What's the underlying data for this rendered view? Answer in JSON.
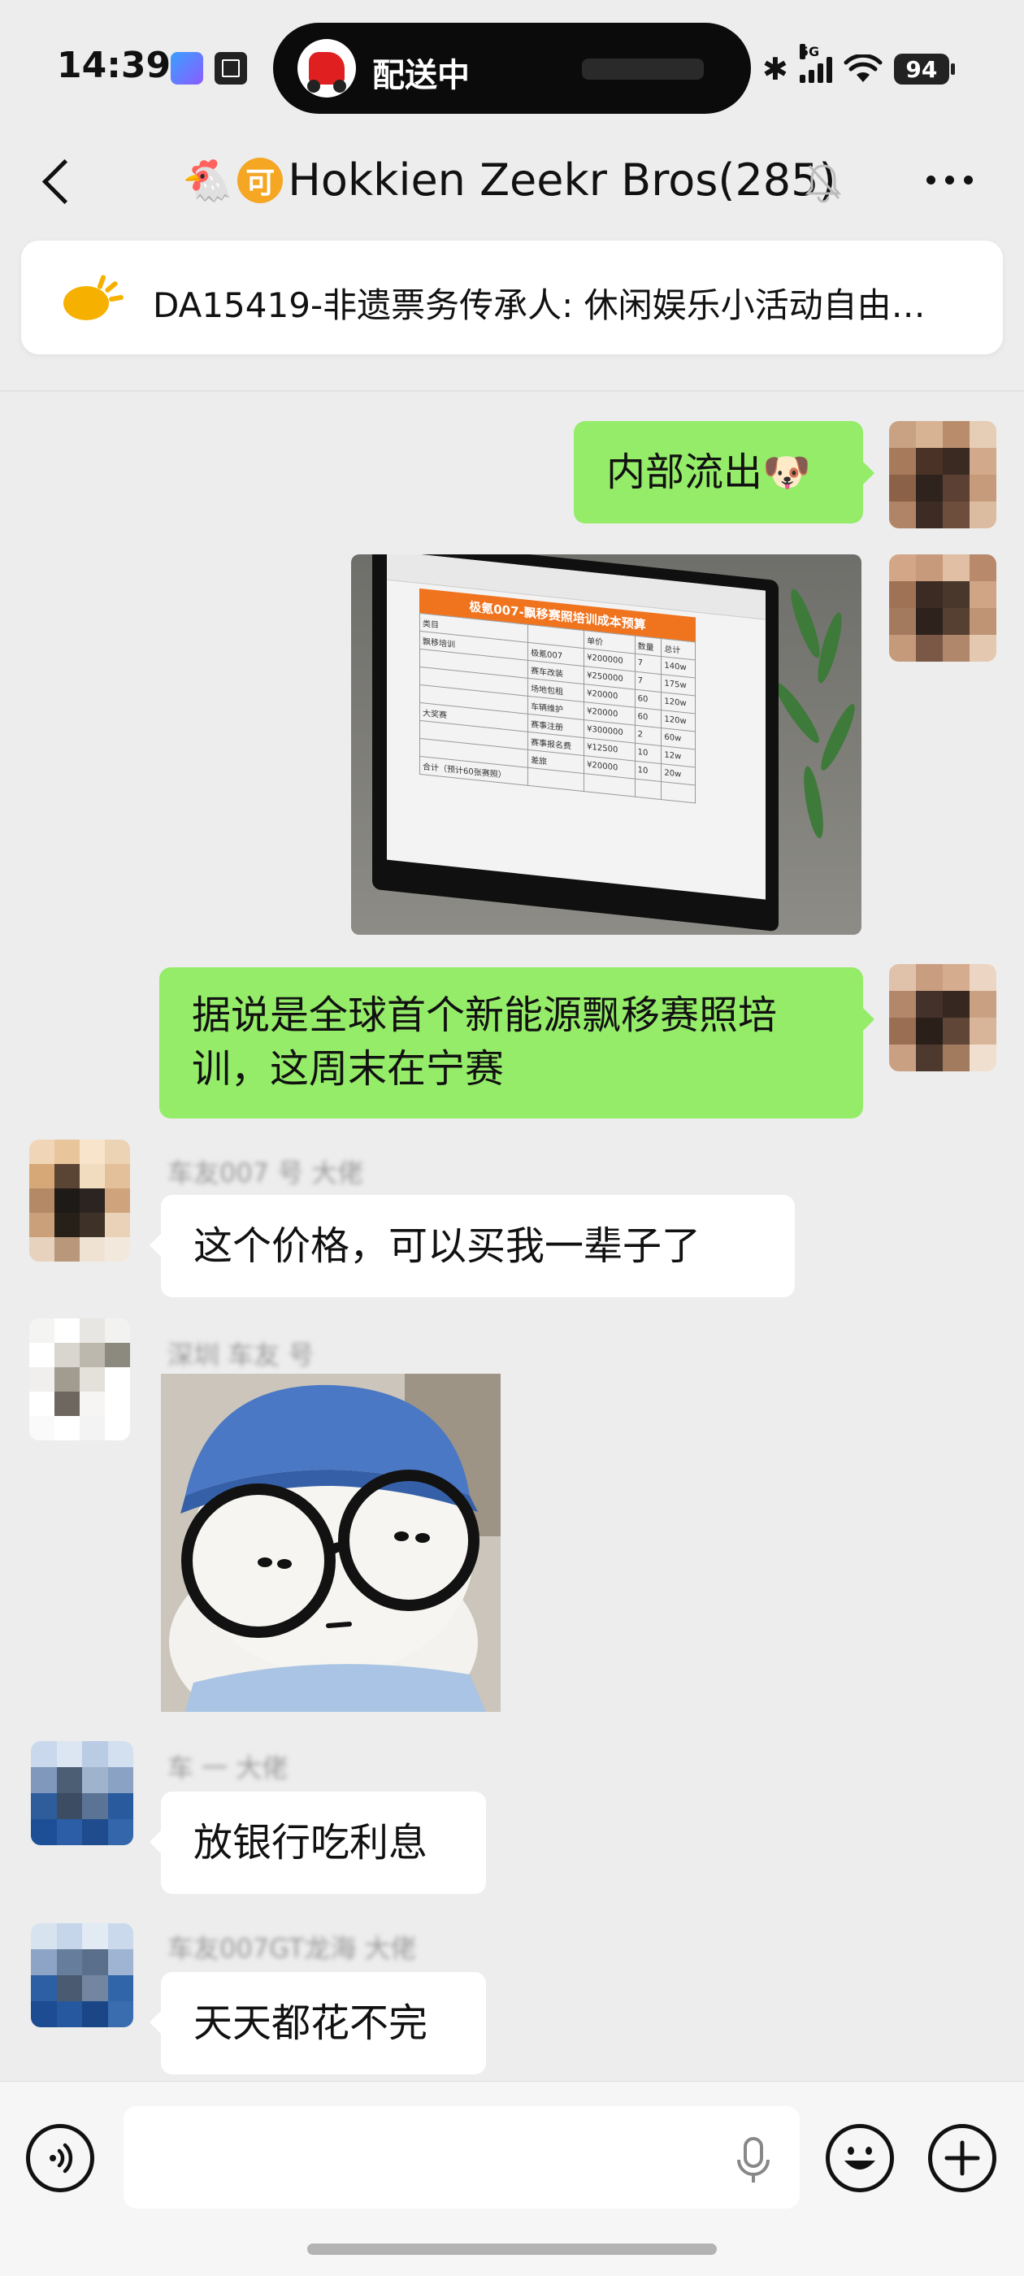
{
  "status_bar": {
    "time": "14:39",
    "live_activity_text": "配送中",
    "network": "5G",
    "battery": "94"
  },
  "header": {
    "title": "Hokkien Zeekr Bros(285)",
    "title_badge": "可",
    "title_emoji": "🐔"
  },
  "announcement": {
    "text": "DA15419-非遗票务传承人: 休闲娱乐小活动自由…"
  },
  "messages": [
    {
      "direction": "out",
      "type": "text",
      "text": "内部流出",
      "emoji": "🐶"
    },
    {
      "direction": "out",
      "type": "image",
      "image": {
        "sheet_title": "极氪007-飘移赛照培训成本预算",
        "rows": [
          [
            "类目",
            "",
            "单价",
            "数量",
            "总计"
          ],
          [
            "飘移培训",
            "极氪007",
            "¥200000",
            "7",
            "140w"
          ],
          [
            "",
            "赛车改装",
            "¥250000",
            "7",
            "175w"
          ],
          [
            "",
            "场地包租",
            "¥20000",
            "60",
            "120w"
          ],
          [
            "",
            "车辆维护",
            "¥20000",
            "60",
            "120w"
          ],
          [
            "大奖赛",
            "赛事注册",
            "¥300000",
            "2",
            "60w"
          ],
          [
            "",
            "赛事报名费",
            "¥12500",
            "10",
            "12w"
          ],
          [
            "",
            "差旅",
            "¥20000",
            "10",
            "20w"
          ],
          [
            "合计（预计60张赛照）",
            "",
            "",
            "",
            ""
          ]
        ]
      }
    },
    {
      "direction": "out",
      "type": "text",
      "text": "据说是全球首个新能源飘移赛照培训，这周末在宁赛"
    },
    {
      "direction": "in",
      "type": "text",
      "sender": "车友007 号 大佬",
      "text": "这个价格，可以买我一辈子了"
    },
    {
      "direction": "in",
      "type": "sticker",
      "sender": "深圳 车友 号"
    },
    {
      "direction": "in",
      "type": "text",
      "sender": "车 一 大佬",
      "text": "放银行吃利息"
    },
    {
      "direction": "in",
      "type": "text",
      "sender": "车友007GT龙海 大佬",
      "text": "天天都花不完"
    }
  ],
  "input_bar": {
    "value": "",
    "icons": [
      "voice-icon",
      "microphone-icon",
      "emoji-icon",
      "plus-icon"
    ]
  },
  "colors": {
    "background": "#ededed",
    "outgoing_bubble": "#95ec69",
    "incoming_bubble": "#ffffff",
    "badge_orange": "#f5a623",
    "notice_icon": "#f6b100"
  }
}
